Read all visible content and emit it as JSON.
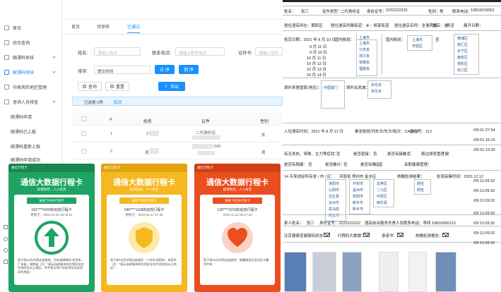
{
  "sidebar": {
    "items": [
      {
        "label": "首页"
      },
      {
        "label": "综合查询"
      },
      {
        "label": "随漂码审核"
      },
      {
        "label": "解漂码审核"
      },
      {
        "label": "中高风险地区管理"
      },
      {
        "label": "查询人员排查"
      },
      {
        "label": "随漂码申请"
      },
      {
        "label": "随漂码已上报"
      },
      {
        "label": "随漂码重新上报"
      },
      {
        "label": "随漂码申请成功"
      }
    ]
  },
  "tabs": [
    {
      "label": "首页"
    },
    {
      "label": "待审核"
    },
    {
      "label": "已通过"
    }
  ],
  "filters": {
    "name_label": "姓名:",
    "name_placeholder": "请输入姓名",
    "phone_label": "联系电话:",
    "phone_placeholder": "请输入联系电话",
    "id_label": "证件号:",
    "id_placeholder": "请输入证件",
    "sort_label": "排序:",
    "sort_value": "提交时间",
    "asc_label": "正 序",
    "desc_label": "倒 序",
    "search_label": "查询",
    "reset_label": "重置",
    "export_label": "导出"
  },
  "selection": {
    "text": "已选择 0项",
    "clear": "取消"
  },
  "table": {
    "headers": [
      "#",
      "姓名",
      "证件",
      "性别"
    ],
    "rows": [
      {
        "num": "1",
        "name": "3",
        "id": "二代身份证",
        "id_no": "",
        "gender": "女"
      },
      {
        "num": "2",
        "name": "吴",
        "id": "043",
        "id_no": "",
        "gender": "男"
      },
      {
        "num": "3",
        "name": "",
        "id": "",
        "id_no": "",
        "gender": ""
      }
    ]
  },
  "phones": [
    {
      "top": "通信行程卡",
      "title": "通信大数据行程卡",
      "subtitle": "疫情防控，人人有责",
      "tag": "请收下绿色行程卡",
      "phone": "181****0430的动态行程卡",
      "update": "更新于：2022.03.28 15:49:01",
      "note": "您于前14天内到达或途经：河北省邯郸市,北京市，广东省，湖南省（注：*表示当前城市所在地区存在中风险及以上地区，并不表示用户实际到访过这些风险地区）",
      "color": "#1ea362"
    },
    {
      "top": "通信行程卡",
      "title": "通信大数据行程卡",
      "subtitle": "疫情防控，人人有责",
      "tag": "请收下黄色行程卡",
      "phone": "186****1168的动态行程卡",
      "update": "更新于：2022.04.17 07:39",
      "note": "您于前14天内到达或途经：广州市,深圳市，东莞市（注：*表示当前城市所在地区存在中风险及以上地区）",
      "color": "#f5b820"
    },
    {
      "top": "通信行程卡",
      "title": "通信大数据行程卡",
      "subtitle": "疫情防控，人人有责",
      "tag": "请收下红色行程卡",
      "phone": "139****3233的动态行程卡",
      "update": "2022.11.22 09:17:10",
      "note": "您于前14天内到达或途经：新疆维吾尔自治区乌鲁木齐市",
      "color": "#eb4e1f"
    }
  ],
  "doc": {
    "name_label": "姓名：",
    "name": "张三",
    "idtype_label": "证件类型：",
    "idtype": "二代身份证",
    "idno_label": "身份证号：",
    "idno": "2222222222",
    "gender_label": "性别：",
    "gender": "男",
    "phone_label": "联系电话：",
    "phone": "13810019001",
    "addr_label": "居住酒店所在：朝阳区",
    "addr2": "居住酒店所属街道：乡：将家街道",
    "addr3": "居住酒店名称：全速宾馆",
    "addr4": "酒店：是",
    "addr5": "青否",
    "addr6": "离开日期：",
    "depart_label": "抵京日期：2021 年 8 月 10 日",
    "domestic_label": "国内航班：",
    "city_col1": [
      "上海市",
      "上海市",
      "江苏省",
      "浙江省",
      "安徽省",
      "福建省"
    ],
    "city_col2": [
      "上海市",
      "市辖区"
    ],
    "city_col3": [
      "黄浦区",
      "徐汇区",
      "长宁区",
      "静安区",
      "普陀区",
      "虹口区"
    ],
    "month_days": [
      "9 月 11 日",
      "9 月 10 日",
      "10 月 11 日",
      "10 月 12 日",
      "10 月 13 日",
      "10 月 14 日"
    ],
    "foreign_label": "境外来居国家(地区)：",
    "foreign_city": "中国澳门",
    "foreign_type": "境外出发城：",
    "foreign_val": "多伦多",
    "arrive_label": "入住酒店时间：2021 年 8 月 12 日",
    "flight_label": "乘坐航班/列车次/车次/船次：CA1502",
    "seat_label": "座位号：12J",
    "symptom_label": "有无发热、咳嗽、主力等症状：",
    "contact_label": "是否密接：",
    "close_label": "是否有接触：",
    "isolate_label": "是否有隔离：",
    "conf_label": "是否确诊：",
    "track_label": "周边排查管理：",
    "track2_label": "是否有确定：",
    "contact2_label": "采取健康管理：",
    "yes": "是",
    "no": "否",
    "travel_label": "14 天来途经所有省 / 市 / 区：",
    "travel_province": "河南省 郑州市 金水区",
    "cities_a": [
      "洛阳市",
      "沁阳市",
      "沈丘县",
      "汝州市",
      "驻马店",
      "商丘市"
    ],
    "cities_b": [
      "开封市",
      "孟州市",
      "安阳市",
      "新乡市",
      "新乡市"
    ],
    "cities_c": [
      "龙亭区",
      "二七区",
      "中原区",
      "西华县"
    ],
    "nucleic_label": "核酸检测结果：",
    "nucleic_result": [
      "阴性",
      "阴性"
    ],
    "nucleic_time_label": "检测采集时间：2021.12.12",
    "family_label": "家人姓名：",
    "family_name": "张三",
    "family_id": "身份证号：2222222222",
    "hotel_contact": "酒店前台服务负责人及联系电话：李四 19810000123",
    "health_label": "北京健康宝健康码状态：",
    "trip_label": "行程码大数据：",
    "commit_label": "承诺书：",
    "test_label": "核酸检测报告：",
    "timestamps": [
      "/09 01:27:54",
      "/09 01:16:19",
      "/09 01:13:39",
      "/09 11:09:32",
      "/09 11:09:32",
      "/09 11:09:32",
      "/09 11:09:32",
      "/09 11:09:32",
      "/09 11:09:32",
      "/09 11:09:32",
      "/09 01:12:53",
      "/09 11:09:32",
      "/09 11:09:32"
    ]
  },
  "colors": {
    "primary": "#1890ff",
    "green": "#1ea362",
    "yellow": "#f5b820",
    "red": "#eb4e1f"
  }
}
